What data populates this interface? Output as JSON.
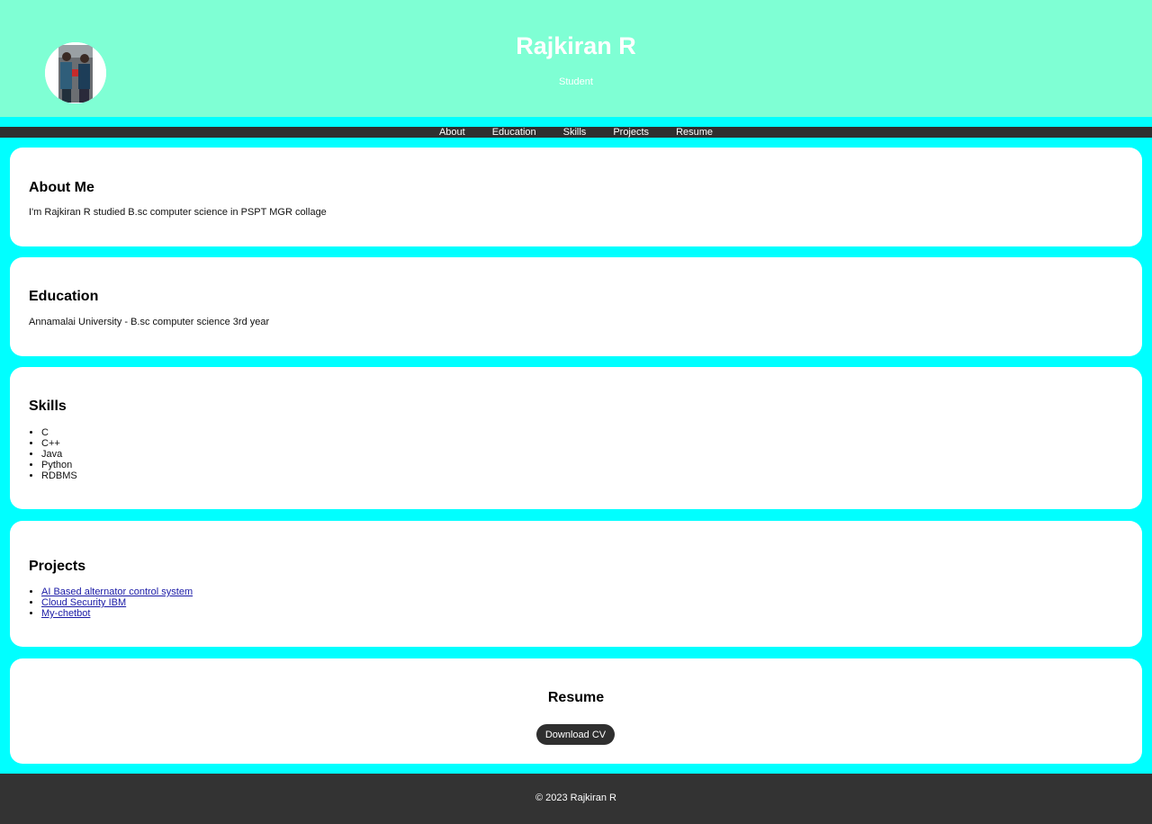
{
  "header": {
    "title": "Rajkiran R",
    "subtitle": "Student",
    "background": "#7fffd4"
  },
  "nav": {
    "items": [
      "About",
      "Education",
      "Skills",
      "Projects",
      "Resume"
    ]
  },
  "about": {
    "heading": "About Me",
    "text": "I'm Rajkiran R studied B.sc computer science in PSPT MGR collage"
  },
  "education": {
    "heading": "Education",
    "text": "Annamalai University - B.sc computer science 3rd year"
  },
  "skills": {
    "heading": "Skills",
    "items": [
      "C",
      "C++",
      "Java",
      "Python",
      "RDBMS"
    ]
  },
  "projects": {
    "heading": "Projects",
    "items": [
      "AI Based alternator control system",
      "Cloud Security IBM",
      "My-chetbot"
    ]
  },
  "resume": {
    "heading": "Resume",
    "button_label": "Download CV"
  },
  "footer": {
    "text": "© 2023 Rajkiran R"
  },
  "colors": {
    "page_background": "#00ffff",
    "nav_background": "#2f2f2f",
    "footer_background": "#333333",
    "link": "#1a1aa6"
  }
}
